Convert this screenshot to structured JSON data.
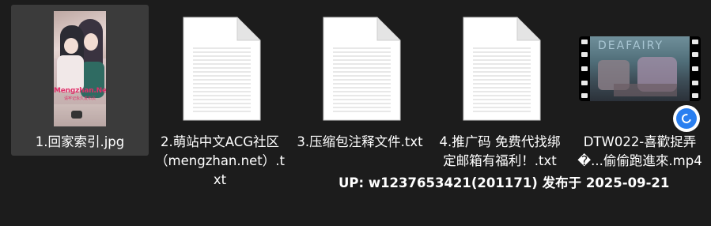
{
  "files": [
    {
      "name": "1.回家索引.jpg",
      "type": "image",
      "icon": "image-thumbnail",
      "selected": true,
      "thumb_watermark": "Mengzhan.Net",
      "thumb_watermark_sub": "请牢记永久发布页"
    },
    {
      "name": "2.萌站中文ACG社区（mengzhan.net）.txt",
      "type": "text",
      "icon": "text-document-icon",
      "selected": false
    },
    {
      "name": "3.压缩包注释文件.txt",
      "type": "text",
      "icon": "text-document-icon",
      "selected": false
    },
    {
      "name": "4.推广码 免费代找绑定邮箱有福利！.txt",
      "type": "text",
      "icon": "text-document-icon",
      "selected": false
    },
    {
      "name": "DTW022-喜歡捉弄�...偷偷跑進來.mp4",
      "type": "video",
      "icon": "video-thumbnail",
      "selected": false,
      "thumb_logo": "DEAFAIRY"
    }
  ],
  "overlay": {
    "text": "UP: w1237653421(201171) 发布于 2025-09-21"
  },
  "badge": {
    "icon": "blue-circle-app-badge-icon",
    "color": "#2a7ff0"
  },
  "colors": {
    "background": "#1c1c1c",
    "selection": "#3b3b3b",
    "text": "#ffffff"
  }
}
